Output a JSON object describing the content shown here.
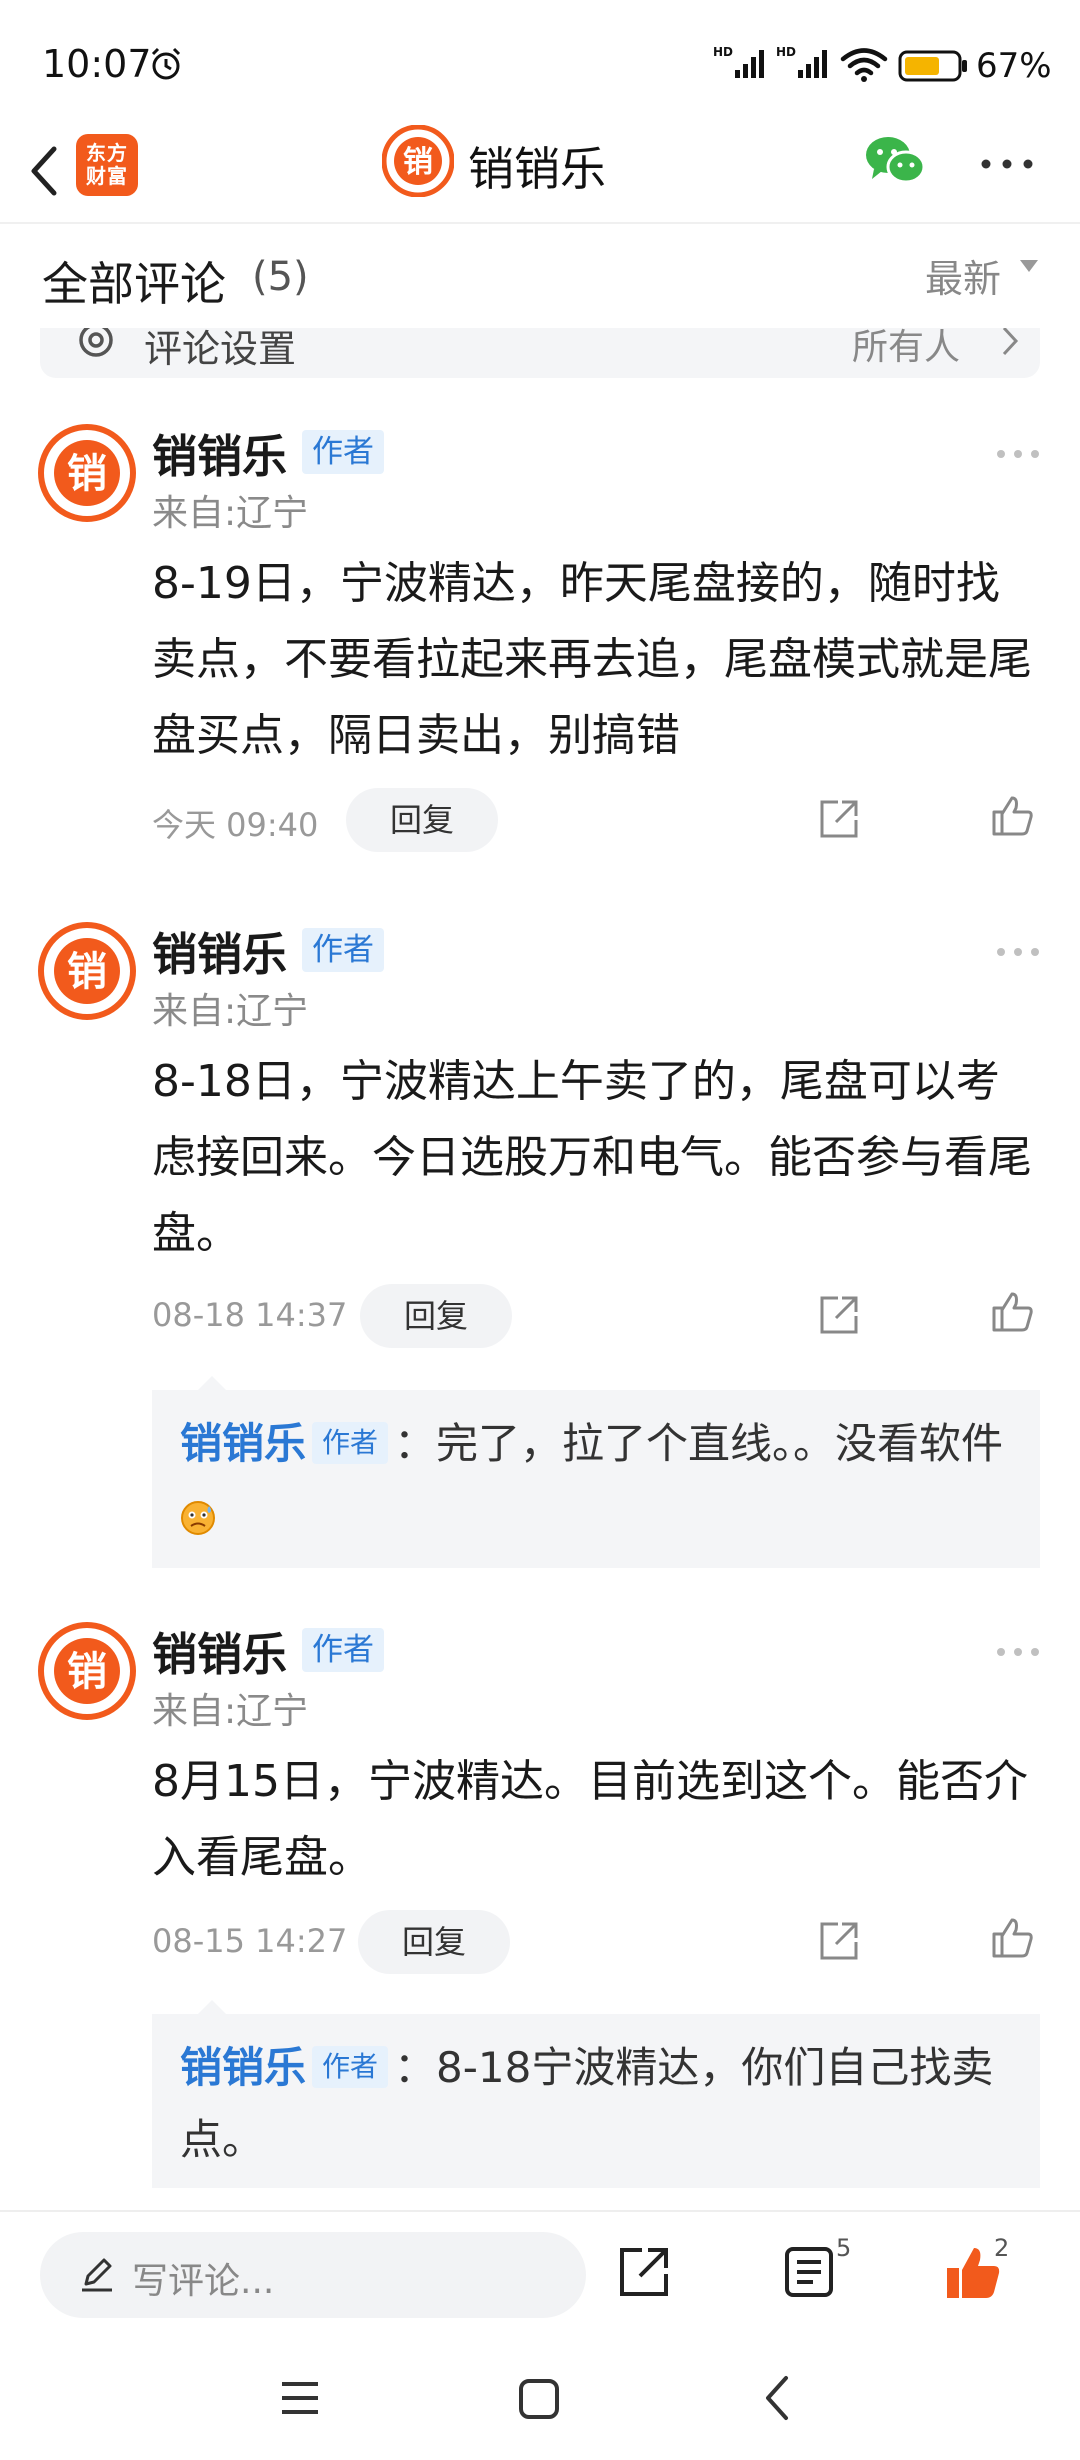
{
  "status_bar": {
    "time": "10:07",
    "battery": "67%",
    "battery_level": 0.67,
    "icons": [
      "alarm-icon",
      "signal-hd-icon",
      "signal-hd-icon",
      "wifi-icon",
      "battery-icon"
    ]
  },
  "nav": {
    "brand_logo_text": "东方财富",
    "title": "销销乐",
    "avatar_char": "销",
    "icons": [
      "back-icon",
      "wechat-icon",
      "more-icon"
    ]
  },
  "comments_header": {
    "title": "全部评论",
    "count": "(5)",
    "sort_label": "最新"
  },
  "settings_bar": {
    "label": "评论设置",
    "value": "所有人"
  },
  "comments": [
    {
      "author": "销销乐",
      "badge": "作者",
      "from": "来自:辽宁",
      "text": "8-19日，宁波精达，昨天尾盘接的，随时找卖点，不要看拉起来再去追，尾盘模式就是尾盘买点，隔日卖出，别搞错",
      "time": "今天 09:40",
      "reply_label": "回复"
    },
    {
      "author": "销销乐",
      "badge": "作者",
      "from": "来自:辽宁",
      "text": "8-18日，宁波精达上午卖了的，尾盘可以考虑接回来。今日选股万和电气。能否参与看尾盘。",
      "time": "08-18 14:37",
      "reply_label": "回复",
      "reply": {
        "author": "销销乐",
        "badge": "作者",
        "text": "：完了，拉了个直线。。没看软件"
      }
    },
    {
      "author": "销销乐",
      "badge": "作者",
      "from": "来自:辽宁",
      "text": "8月15日，宁波精达。目前选到这个。能否介入看尾盘。",
      "time": "08-15 14:27",
      "reply_label": "回复",
      "reply": {
        "author": "销销乐",
        "badge": "作者",
        "text": "：8-18宁波精达，你们自己找卖点。"
      }
    }
  ],
  "bottom_bar": {
    "write_placeholder": "写评论...",
    "list_count": "5",
    "like_count": "2"
  },
  "colors": {
    "brand_orange": "#f25a1c",
    "link_blue": "#2a78d4",
    "badge_bg": "#e6f1fc",
    "wechat_green": "#3bb54a"
  }
}
